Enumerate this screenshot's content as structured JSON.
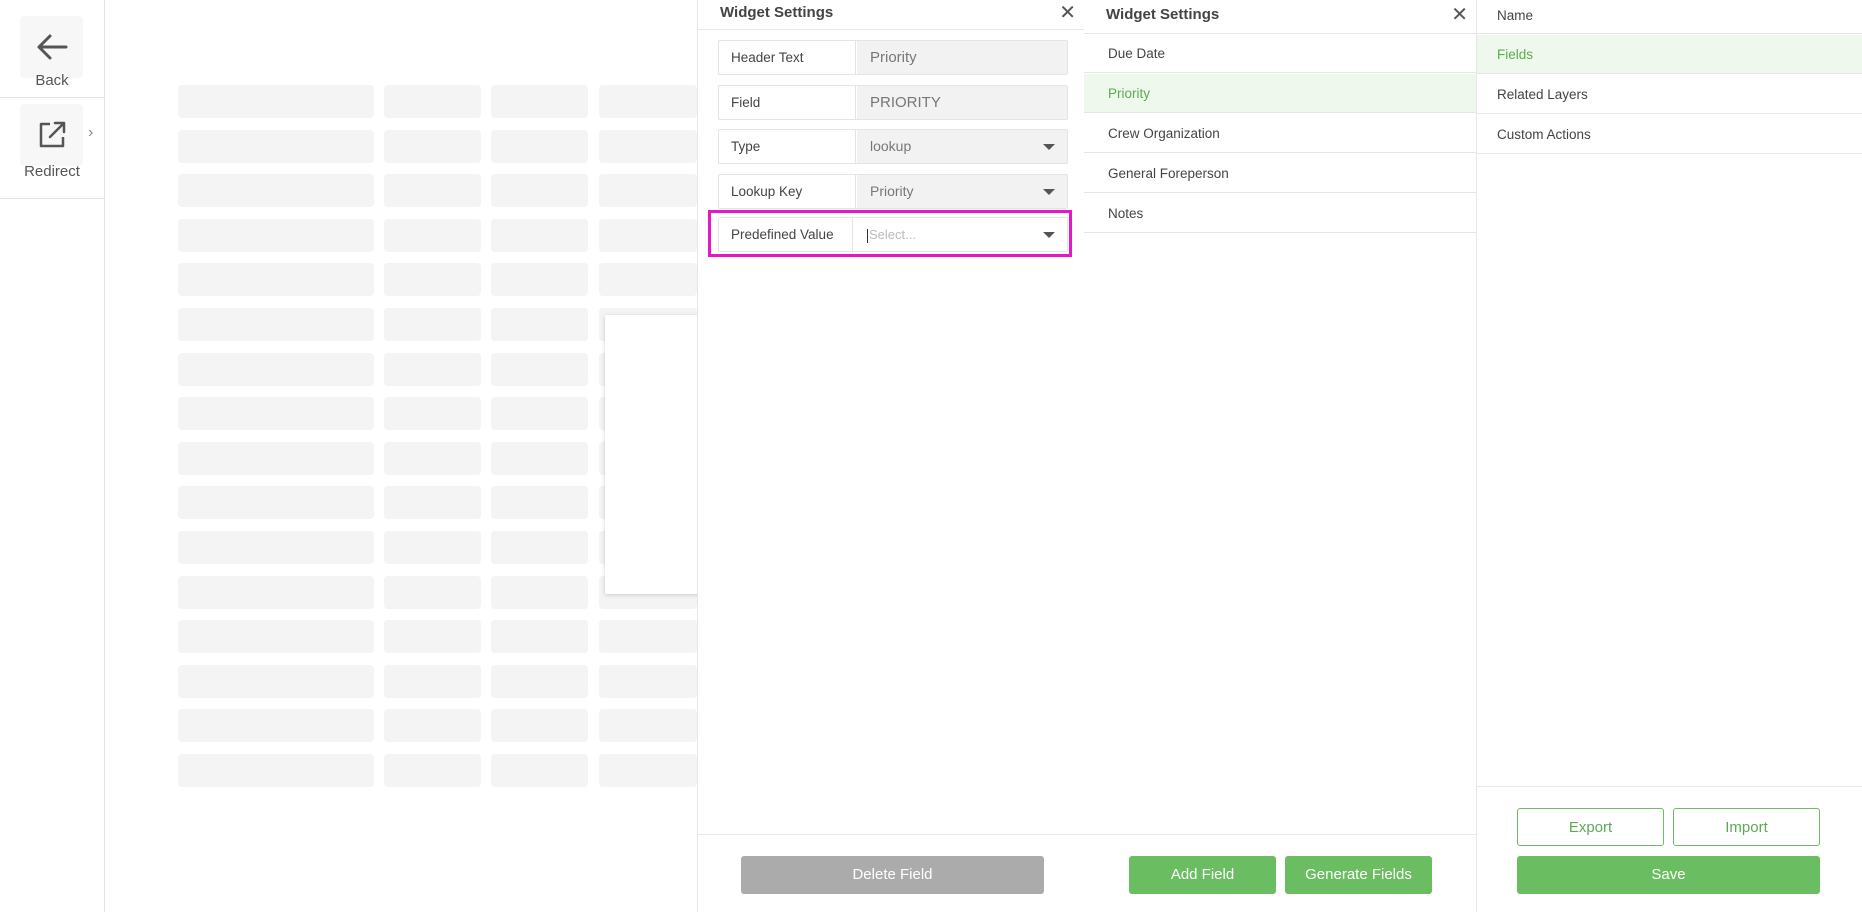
{
  "rail": {
    "back_label": "Back",
    "redirect_label": "Redirect",
    "expand_icon": "›"
  },
  "field_settings": {
    "title": "Widget Settings",
    "close": "✕",
    "rows": [
      {
        "label": "Header Text",
        "value": "Priority"
      },
      {
        "label": "Field",
        "value": "PRIORITY"
      },
      {
        "label": "Type",
        "value": "lookup"
      },
      {
        "label": "Lookup Key",
        "value": "Priority"
      }
    ],
    "predefined": {
      "label": "Predefined Value",
      "placeholder": "Select..."
    },
    "delete_label": "Delete Field"
  },
  "fields_panel": {
    "title": "Widget Settings",
    "close": "✕",
    "items": [
      "Due Date",
      "Priority",
      "Crew Organization",
      "General Foreperson",
      "Notes"
    ],
    "active_item": "Priority",
    "add_label": "Add Field",
    "generate_label": "Generate Fields"
  },
  "nav_panel": {
    "items": [
      "Name",
      "Fields",
      "Related Layers",
      "Custom Actions"
    ],
    "active_item": "Fields",
    "export_label": "Export",
    "import_label": "Import",
    "save_label": "Save"
  },
  "colors": {
    "accent": "#6abe61",
    "highlight": "#e517c8",
    "disabled": "#ababab"
  }
}
